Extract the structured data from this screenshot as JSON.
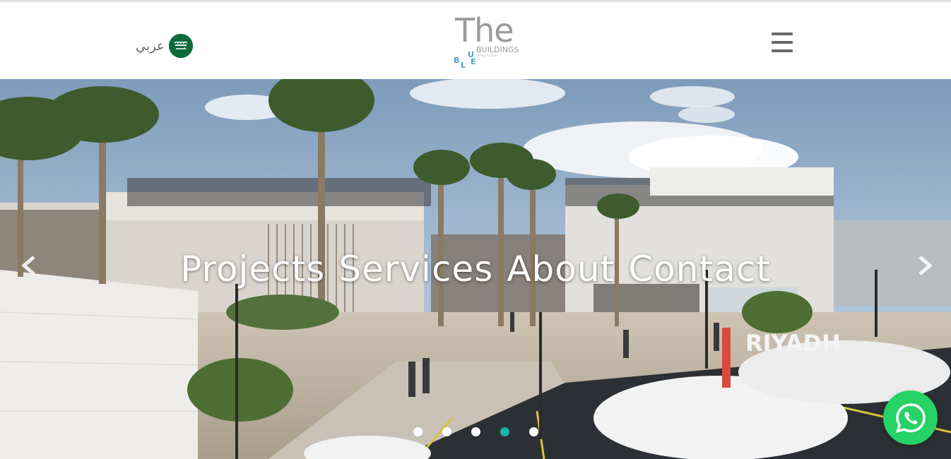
{
  "header": {
    "language_label": "عربي",
    "logo": {
      "the": "The",
      "buildings": "BUILDINGS",
      "tagline": "Design & Build",
      "blue_letters": [
        "B",
        "L",
        "U",
        "E"
      ]
    },
    "menu_icon": "hamburger-icon"
  },
  "hero": {
    "nav_links": [
      "Projects",
      "Services",
      "About",
      "Contact"
    ],
    "prev_icon": "chevron-left-icon",
    "next_icon": "chevron-right-icon",
    "slides_count": 5,
    "active_slide": 4,
    "active_dot_color": "#1ab3aa"
  },
  "floating": {
    "whatsapp_icon": "whatsapp-icon",
    "whatsapp_color": "#25d366"
  }
}
